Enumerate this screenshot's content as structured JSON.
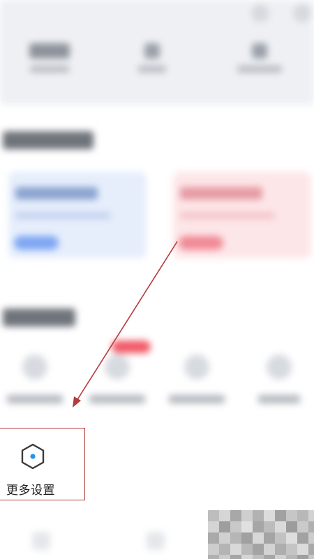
{
  "highlight": {
    "label": "更多设置",
    "icon": "settings-hexagon-icon",
    "accent_color": "#2196f3",
    "border_color": "#b63a3a"
  },
  "annotation": {
    "arrow_color": "#b63a3a"
  },
  "background": {
    "blurred": true,
    "card_colors": [
      "#e6eefc",
      "#fde6e8"
    ],
    "badge_color": "#f15865"
  }
}
